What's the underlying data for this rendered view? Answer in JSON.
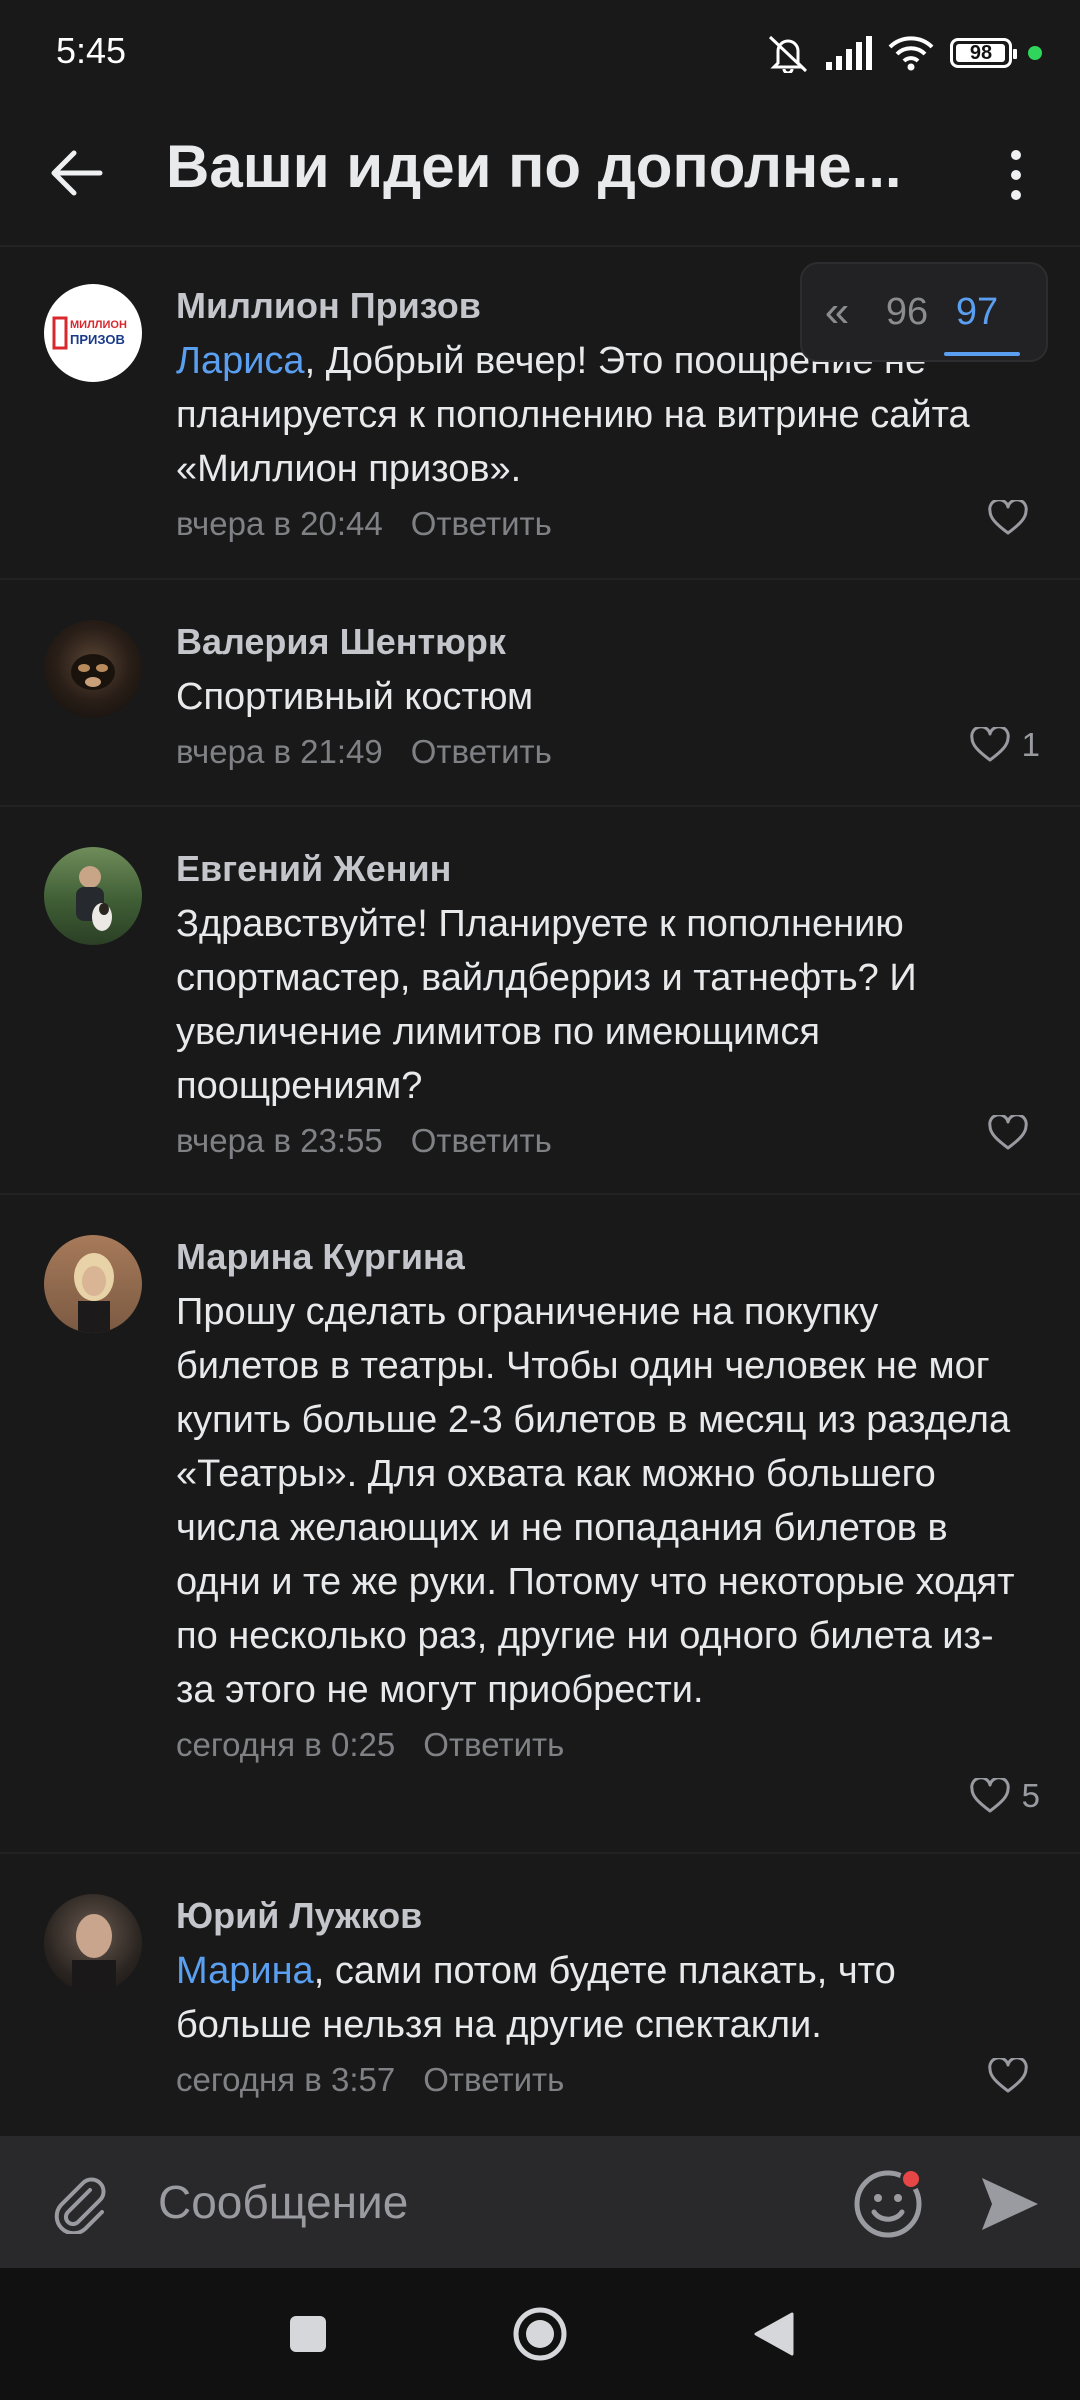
{
  "status_bar": {
    "time": "5:45",
    "battery": "98"
  },
  "header": {
    "title": "Ваши идеи по дополне..."
  },
  "pager": {
    "prev": "«",
    "pages": [
      "96",
      "97"
    ],
    "active": "97"
  },
  "comments": [
    {
      "author": "Миллион Призов",
      "avatar_text": [
        "МИЛЛИОН",
        "ПРИЗОВ"
      ],
      "mention": "Лариса",
      "text": ", Добрый вечер! Это поощрение не планируется к пополнению на витрине сайта «Миллион призов».",
      "time": "вчера в 20:44",
      "reply": "Ответить",
      "likes": ""
    },
    {
      "author": "Валерия Шентюрк",
      "mention": "",
      "text": "Спортивный костюм",
      "time": "вчера в 21:49",
      "reply": "Ответить",
      "likes": "1"
    },
    {
      "author": "Евгений Женин",
      "mention": "",
      "text": "Здравствуйте! Планируете к пополнению спортмастер, вайлдберриз и татнефть? И увеличение лимитов по имеющимся поощрениям?",
      "time": "вчера в 23:55",
      "reply": "Ответить",
      "likes": ""
    },
    {
      "author": "Марина Кургина",
      "mention": "",
      "text": "Прошу сделать ограничение на покупку билетов в театры. Чтобы один человек не мог купить больше 2-3 билетов в месяц из раздела «Театры». Для охвата как можно большего числа желающих и не попадания билетов в одни и те же руки. Потому что некоторые ходят по несколько раз, другие ни одного билета из-за этого не могут приобрести.",
      "time": "сегодня в 0:25",
      "reply": "Ответить",
      "likes": "5"
    },
    {
      "author": "Юрий Лужков",
      "mention": "Марина",
      "text": ", сами потом будете плакать, что больше нельзя на другие спектакли.",
      "time": "сегодня в 3:57",
      "reply": "Ответить",
      "likes": ""
    }
  ],
  "composer": {
    "placeholder": "Сообщение"
  },
  "icons": {
    "back": "arrow-left-icon",
    "more": "vertical-dots-icon",
    "like": "heart-outline-icon",
    "attach": "paperclip-icon",
    "emoji": "smiley-icon",
    "send": "send-arrow-icon"
  },
  "colors": {
    "background": "#19191a",
    "accent": "#5a9ff0",
    "muted": "#808185",
    "online": "#2fd65b",
    "badge": "#e64646"
  }
}
